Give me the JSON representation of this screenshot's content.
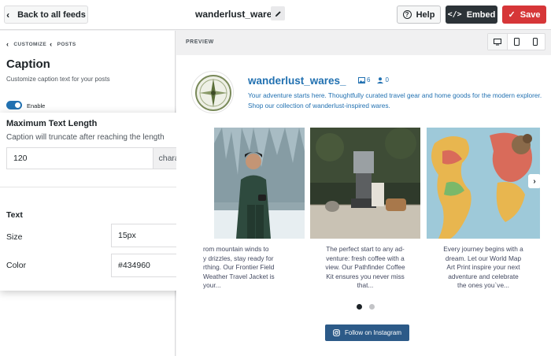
{
  "header": {
    "back_label": "Back to all feeds",
    "feed_name": "wanderlust_wares_",
    "help_label": "Help",
    "embed_label": "Embed",
    "save_label": "Save"
  },
  "sidebar": {
    "breadcrumb": [
      "CUSTOMIZE",
      "POSTS"
    ],
    "title": "Caption",
    "description": "Customize caption text for your posts",
    "enable_label": "Enable",
    "enabled": true
  },
  "caption_settings": {
    "max_length_heading": "Maximum Text Length",
    "max_length_hint": "Caption will truncate after reaching the length",
    "max_length_value": "120",
    "max_length_unit": "characters",
    "text_heading": "Text",
    "size_label": "Size",
    "size_value": "15px",
    "color_label": "Color",
    "color_value": "#434960"
  },
  "preview": {
    "label": "PREVIEW",
    "username": "wanderlust_wares_",
    "posts_count": "6",
    "followers_count": "0",
    "bio": "Your adventure starts here. Thoughtfully curated travel gear and home goods for the modern explorer. Shop our collection of wanderlust-inspired wares.",
    "posts": [
      {
        "caption": "rom mountain winds to\ny drizzles, stay ready for\nrthing. Our Frontier Field\nWeather Travel Jacket is\nyour..."
      },
      {
        "caption": "The perfect start to any ad-\nventure: fresh coffee with a\nview. Our Pathfinder Coffee\nKit ensures you never miss\nthat..."
      },
      {
        "caption": "Every journey begins with a\ndream. Let our World Map\nArt Print inspire your next\nadventure and celebrate\nthe ones you`ve..."
      }
    ],
    "follow_label": "Follow on Instagram"
  },
  "colors": {
    "accent": "#2271b1",
    "embed": "#2c3338",
    "save": "#d63638",
    "caption_text": "#434960",
    "follow_button": "#2c5a88"
  }
}
